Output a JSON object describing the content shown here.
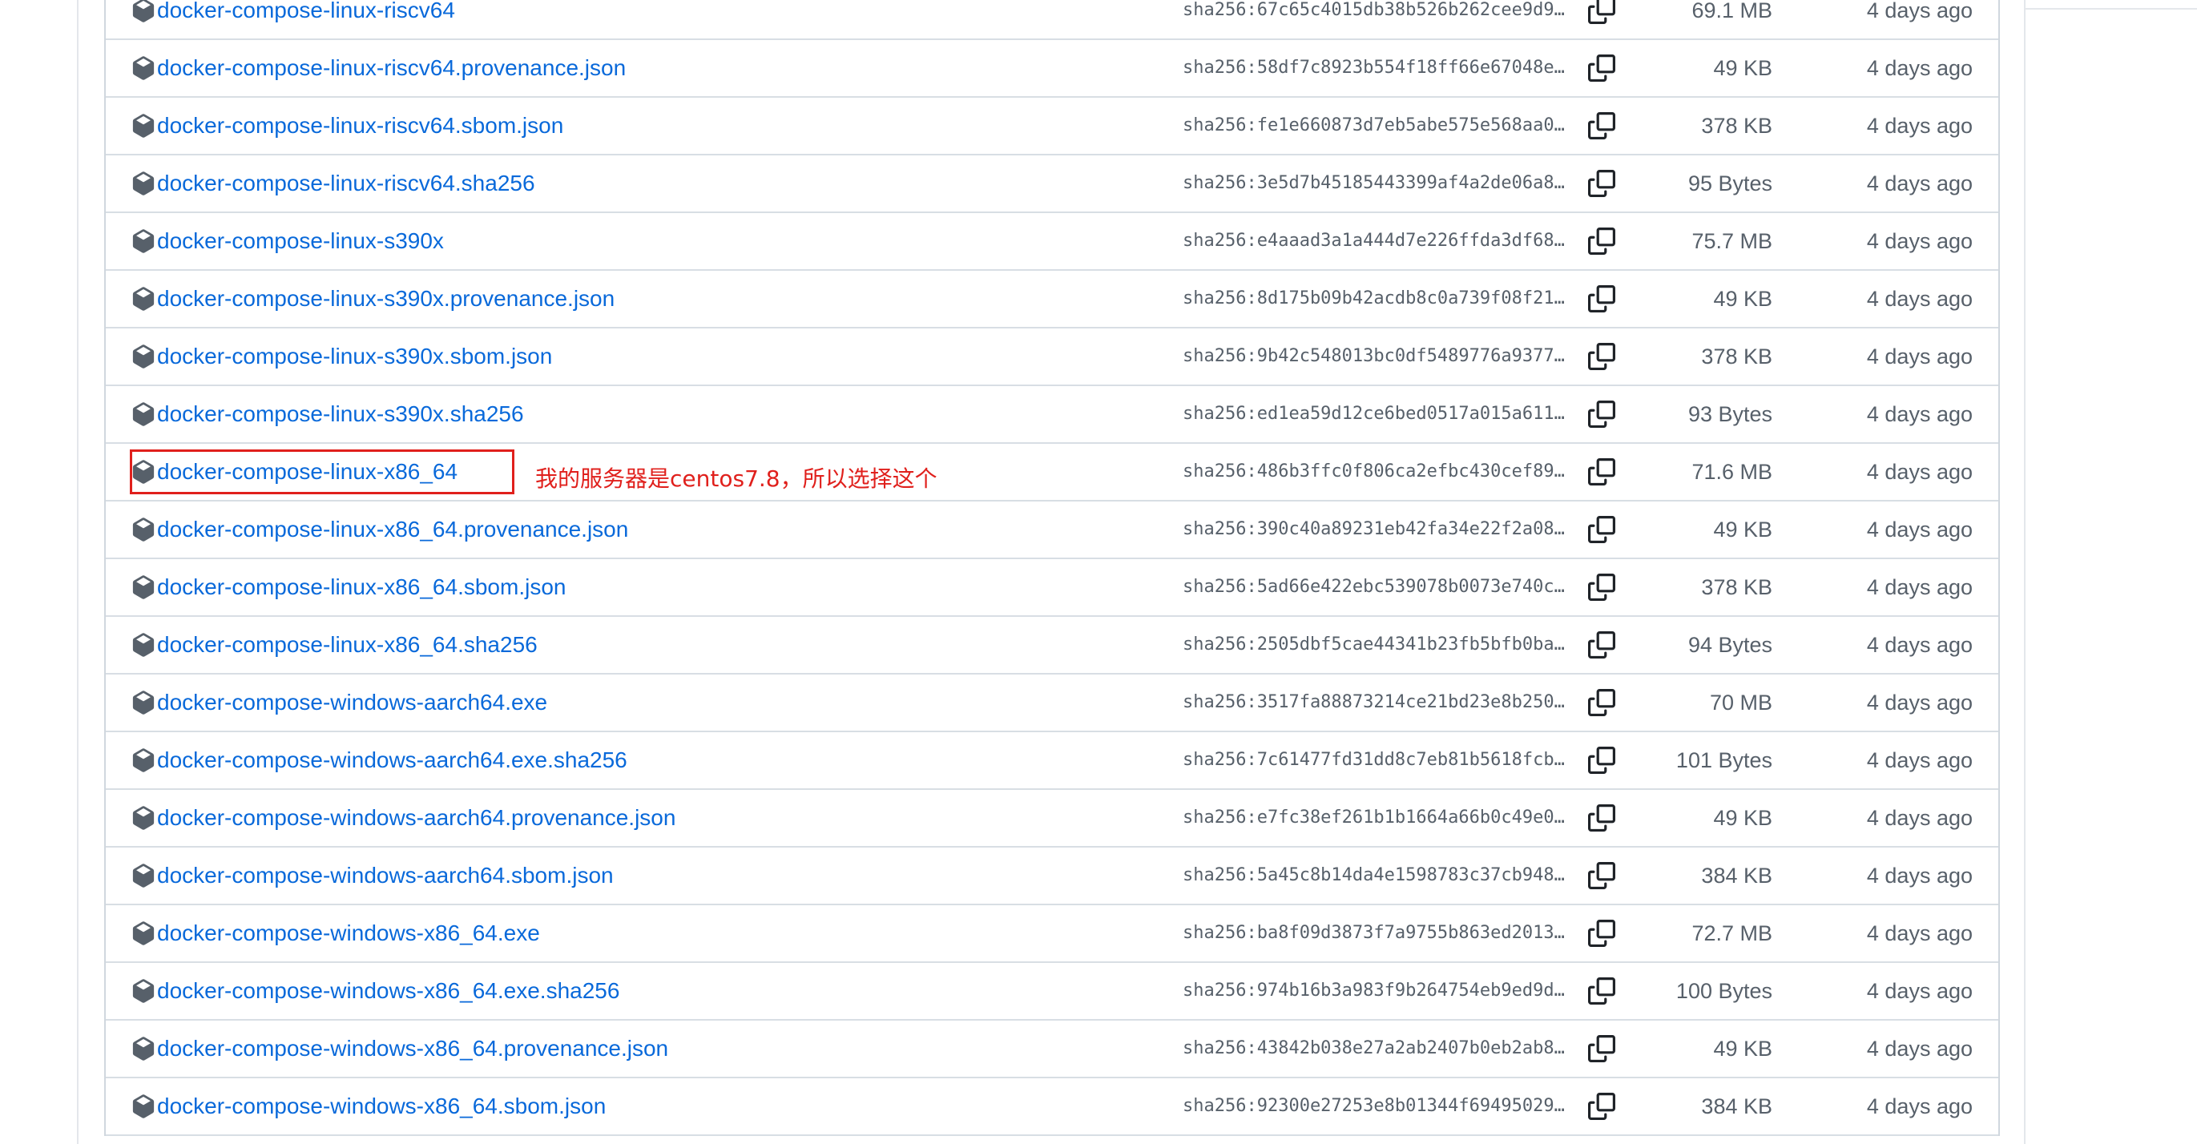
{
  "annotation": {
    "text": "我的服务器是centos7.8，所以选择这个",
    "color": "#e0201c"
  },
  "colors": {
    "link": "#0969da",
    "muted": "#57606a",
    "border": "#d8dee4"
  },
  "assets": [
    {
      "name": "docker-compose-linux-riscv64",
      "digest": "sha256:67c65c4015db38b526b262cee9d98...",
      "size": "69.1 MB",
      "date": "4 days ago"
    },
    {
      "name": "docker-compose-linux-riscv64.provenance.json",
      "digest": "sha256:58df7c8923b554f18ff66e67048ec...",
      "size": "49 KB",
      "date": "4 days ago"
    },
    {
      "name": "docker-compose-linux-riscv64.sbom.json",
      "digest": "sha256:fe1e660873d7eb5abe575e568aa0a...",
      "size": "378 KB",
      "date": "4 days ago"
    },
    {
      "name": "docker-compose-linux-riscv64.sha256",
      "digest": "sha256:3e5d7b45185443399af4a2de06a8a...",
      "size": "95 Bytes",
      "date": "4 days ago"
    },
    {
      "name": "docker-compose-linux-s390x",
      "digest": "sha256:e4aaad3a1a444d7e226ffda3df687...",
      "size": "75.7 MB",
      "date": "4 days ago"
    },
    {
      "name": "docker-compose-linux-s390x.provenance.json",
      "digest": "sha256:8d175b09b42acdb8c0a739f08f219...",
      "size": "49 KB",
      "date": "4 days ago"
    },
    {
      "name": "docker-compose-linux-s390x.sbom.json",
      "digest": "sha256:9b42c548013bc0df5489776a9377f...",
      "size": "378 KB",
      "date": "4 days ago"
    },
    {
      "name": "docker-compose-linux-s390x.sha256",
      "digest": "sha256:ed1ea59d12ce6bed0517a015a6117...",
      "size": "93 Bytes",
      "date": "4 days ago"
    },
    {
      "name": "docker-compose-linux-x86_64",
      "digest": "sha256:486b3ffc0f806ca2efbc430cef899...",
      "size": "71.6 MB",
      "date": "4 days ago"
    },
    {
      "name": "docker-compose-linux-x86_64.provenance.json",
      "digest": "sha256:390c40a89231eb42fa34e22f2a084...",
      "size": "49 KB",
      "date": "4 days ago"
    },
    {
      "name": "docker-compose-linux-x86_64.sbom.json",
      "digest": "sha256:5ad66e422ebc539078b0073e740cc...",
      "size": "378 KB",
      "date": "4 days ago"
    },
    {
      "name": "docker-compose-linux-x86_64.sha256",
      "digest": "sha256:2505dbf5cae44341b23fb5bfb0baf...",
      "size": "94 Bytes",
      "date": "4 days ago"
    },
    {
      "name": "docker-compose-windows-aarch64.exe",
      "digest": "sha256:3517fa88873214ce21bd23e8b2500...",
      "size": "70 MB",
      "date": "4 days ago"
    },
    {
      "name": "docker-compose-windows-aarch64.exe.sha256",
      "digest": "sha256:7c61477fd31dd8c7eb81b5618fcbe...",
      "size": "101 Bytes",
      "date": "4 days ago"
    },
    {
      "name": "docker-compose-windows-aarch64.provenance.json",
      "digest": "sha256:e7fc38ef261b1b1664a66b0c49e07...",
      "size": "49 KB",
      "date": "4 days ago"
    },
    {
      "name": "docker-compose-windows-aarch64.sbom.json",
      "digest": "sha256:5a45c8b14da4e1598783c37cb9487...",
      "size": "384 KB",
      "date": "4 days ago"
    },
    {
      "name": "docker-compose-windows-x86_64.exe",
      "digest": "sha256:ba8f09d3873f7a9755b863ed2013a...",
      "size": "72.7 MB",
      "date": "4 days ago"
    },
    {
      "name": "docker-compose-windows-x86_64.exe.sha256",
      "digest": "sha256:974b16b3a983f9b264754eb9ed9d0...",
      "size": "100 Bytes",
      "date": "4 days ago"
    },
    {
      "name": "docker-compose-windows-x86_64.provenance.json",
      "digest": "sha256:43842b038e27a2ab2407b0eb2ab80...",
      "size": "49 KB",
      "date": "4 days ago"
    },
    {
      "name": "docker-compose-windows-x86_64.sbom.json",
      "digest": "sha256:92300e27253e8b01344f69495029c...",
      "size": "384 KB",
      "date": "4 days ago"
    }
  ]
}
